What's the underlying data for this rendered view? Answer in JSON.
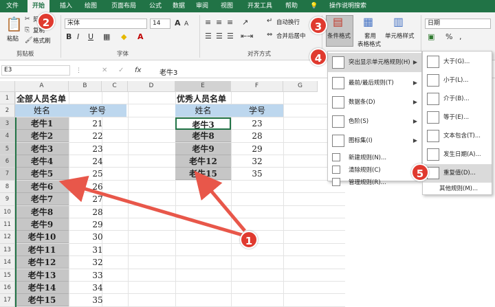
{
  "tabs": [
    "文件",
    "开始",
    "插入",
    "绘图",
    "页面布局",
    "公式",
    "数据",
    "审阅",
    "视图",
    "开发工具",
    "帮助",
    "操作说明搜索"
  ],
  "clipboard": {
    "paste": "粘贴",
    "cut": "剪切",
    "copy": "复制",
    "format_painter": "格式刷",
    "group": "剪贴板"
  },
  "font": {
    "name": "宋体",
    "size": "14",
    "group": "字体",
    "bold": "B",
    "italic": "I",
    "underline": "U",
    "grow": "A",
    "shrink": "A"
  },
  "alignment": {
    "wrap": "自动换行",
    "merge": "合并后居中",
    "group": "对齐方式"
  },
  "styles": {
    "conditional": "条件格式",
    "table": "套用",
    "table2": "表格格式",
    "cell_styles": "单元格样式"
  },
  "number": {
    "format": "日期",
    "percent": "%",
    "comma": ","
  },
  "formula_bar": {
    "name_box": "E3",
    "fx": "fx",
    "value": "老牛3"
  },
  "columns": [
    "A",
    "B",
    "C",
    "D",
    "E",
    "F",
    "G"
  ],
  "rows": [
    "1",
    "2",
    "3",
    "4",
    "5",
    "6",
    "7",
    "8",
    "9",
    "10",
    "11",
    "12",
    "13",
    "14",
    "15",
    "16",
    "17"
  ],
  "sheet": {
    "title_all": "全部人员名单",
    "title_excellent": "优秀人员名单",
    "hdr_name": "姓名",
    "hdr_id": "学号",
    "all": [
      [
        "老牛1",
        "21"
      ],
      [
        "老牛2",
        "22"
      ],
      [
        "老牛3",
        "23"
      ],
      [
        "老牛4",
        "24"
      ],
      [
        "老牛5",
        "25"
      ],
      [
        "老牛6",
        "26"
      ],
      [
        "老牛7",
        "27"
      ],
      [
        "老牛8",
        "28"
      ],
      [
        "老牛9",
        "29"
      ],
      [
        "老牛10",
        "30"
      ],
      [
        "老牛11",
        "31"
      ],
      [
        "老牛12",
        "32"
      ],
      [
        "老牛13",
        "33"
      ],
      [
        "老牛14",
        "34"
      ],
      [
        "老牛15",
        "35"
      ]
    ],
    "excellent": [
      [
        "老牛3",
        "23"
      ],
      [
        "老牛8",
        "28"
      ],
      [
        "老牛9",
        "29"
      ],
      [
        "老牛12",
        "32"
      ],
      [
        "老牛15",
        "35"
      ]
    ]
  },
  "cf_menu": [
    "突出显示单元格规则(H)",
    "最前/最后规则(T)",
    "数据条(D)",
    "色阶(S)",
    "图标集(I)",
    "新建规则(N)...",
    "清除规则(C)",
    "管理规则(R)..."
  ],
  "sub_menu": [
    "大于(G)...",
    "小于(L)...",
    "介于(B)...",
    "等于(E)...",
    "文本包含(T)...",
    "发生日期(A)...",
    "重复值(D)..."
  ],
  "sub_more": "其他规则(M)...",
  "badges": [
    "1",
    "2",
    "3",
    "4",
    "5"
  ],
  "colors": {
    "ribbon_green": "#217346",
    "badge_red": "#e03a2f",
    "arrow_red": "#e8574a"
  }
}
